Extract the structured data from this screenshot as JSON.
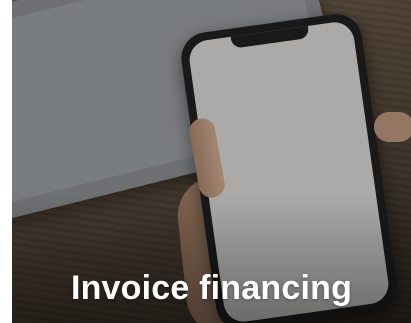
{
  "card": {
    "title": "Invoice financing"
  },
  "image": {
    "description_icon": "phone-in-hand-photo"
  },
  "colors": {
    "title_text": "#ffffff",
    "overlay": "#000000",
    "phone_screen": "#c3c2bf"
  }
}
